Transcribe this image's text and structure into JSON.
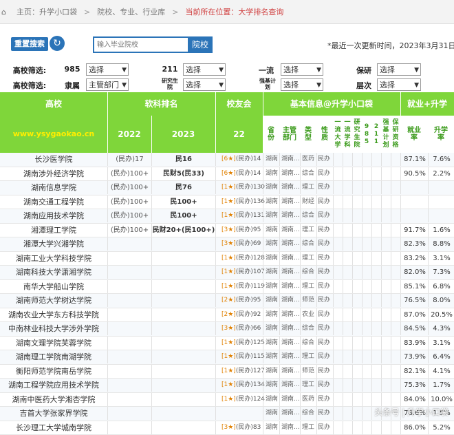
{
  "breadcrumb": {
    "home": "主页",
    "items": [
      "主页：升学小口袋",
      "院校、专业、行业库",
      "当前所在位置：大学排名查询"
    ]
  },
  "search": {
    "logo_label": "重置搜索",
    "placeholder": "输入毕业院校",
    "button": "院校"
  },
  "update": "*最近一次更新时间，2023年3月31日",
  "filters": {
    "row1": [
      {
        "label": "高校筛选:",
        "sublabel": "985",
        "value": "选择"
      },
      {
        "label": "211",
        "value": "选择"
      },
      {
        "label": "一流",
        "value": "选择"
      },
      {
        "label": "保研",
        "value": "选择"
      }
    ],
    "row2": [
      {
        "label": "高校筛选:",
        "sublabel": "隶属",
        "value": "主管部门"
      },
      {
        "label": "研究生院",
        "value": "选择"
      },
      {
        "label": "强基计划",
        "value": "选择"
      },
      {
        "label": "层次",
        "value": "选择"
      }
    ]
  },
  "headers": {
    "school": "高校",
    "ranking": "软科排名",
    "alumni": "校友会",
    "basic": "基本信息@升学小口袋",
    "employ": "就业+升学",
    "site": "www.ysygaokao.cn",
    "y2022": "2022",
    "y2023": "2023",
    "alu22": "22",
    "vcols": [
      "省份",
      "主管部门",
      "类型",
      "性质",
      "一流大学",
      "一流学科",
      "研究生院",
      "985",
      "211",
      "强基计划",
      "保研资格",
      "就业率",
      "升学率"
    ]
  },
  "rows": [
    {
      "name": "长沙医学院",
      "y22": "(民办)17",
      "y23": "民16",
      "alu": "[6★](民办)14",
      "prov": "湖南",
      "dept": "湖南...",
      "type": "医药",
      "nature": "民办",
      "emp": "87.1%",
      "rate": "7.6%"
    },
    {
      "name": "湖南涉外经济学院",
      "y22": "(民办)100+",
      "y23": "民财5(民33)",
      "alu": "[6★](民办)14",
      "prov": "湖南",
      "dept": "湖南...",
      "type": "综合",
      "nature": "民办",
      "emp": "90.5%",
      "rate": "2.2%"
    },
    {
      "name": "湖南信息学院",
      "y22": "(民办)100+",
      "y23": "民76",
      "alu": "[1★](民办)130",
      "prov": "湖南",
      "dept": "湖南...",
      "type": "理工",
      "nature": "民办",
      "emp": "",
      "rate": ""
    },
    {
      "name": "湖南交通工程学院",
      "y22": "(民办)100+",
      "y23": "民100+",
      "alu": "[1★](民办)136",
      "prov": "湖南",
      "dept": "湖南...",
      "type": "财经",
      "nature": "民办",
      "emp": "",
      "rate": ""
    },
    {
      "name": "湖南应用技术学院",
      "y22": "(民办)100+",
      "y23": "民100+",
      "alu": "[1★](民办)131",
      "prov": "湖南",
      "dept": "湖南...",
      "type": "综合",
      "nature": "民办",
      "emp": "",
      "rate": ""
    },
    {
      "name": "湘潭理工学院",
      "y22": "(民办)100+",
      "y23": "民财20+(民100+)",
      "alu": "[3★](民办)95",
      "prov": "湖南",
      "dept": "湖南...",
      "type": "理工",
      "nature": "民办",
      "emp": "91.7%",
      "rate": "1.6%"
    },
    {
      "name": "湘潭大学兴湘学院",
      "y22": "",
      "y23": "",
      "alu": "[3★](民办)69",
      "prov": "湖南",
      "dept": "湖南...",
      "type": "综合",
      "nature": "民办",
      "emp": "82.3%",
      "rate": "8.8%"
    },
    {
      "name": "湖南工业大学科技学院",
      "y22": "",
      "y23": "",
      "alu": "[1★](民办)128",
      "prov": "湖南",
      "dept": "湖南...",
      "type": "理工",
      "nature": "民办",
      "emp": "83.2%",
      "rate": "3.1%"
    },
    {
      "name": "湖南科技大学潇湘学院",
      "y22": "",
      "y23": "",
      "alu": "[1★](民办)107",
      "prov": "湖南",
      "dept": "湖南...",
      "type": "综合",
      "nature": "民办",
      "emp": "82.0%",
      "rate": "7.3%"
    },
    {
      "name": "南华大学船山学院",
      "y22": "",
      "y23": "",
      "alu": "[1★](民办)119",
      "prov": "湖南",
      "dept": "湖南...",
      "type": "理工",
      "nature": "民办",
      "emp": "85.1%",
      "rate": "6.8%"
    },
    {
      "name": "湖南师范大学树达学院",
      "y22": "",
      "y23": "",
      "alu": "[2★](民办)95",
      "prov": "湖南",
      "dept": "湖南...",
      "type": "师范",
      "nature": "民办",
      "emp": "76.5%",
      "rate": "8.0%"
    },
    {
      "name": "湖南农业大学东方科技学院",
      "y22": "",
      "y23": "",
      "alu": "[2★](民办)92",
      "prov": "湖南",
      "dept": "湖南...",
      "type": "农业",
      "nature": "民办",
      "emp": "87.0%",
      "rate": "20.5%"
    },
    {
      "name": "中南林业科技大学涉外学院",
      "y22": "",
      "y23": "",
      "alu": "[3★](民办)66",
      "prov": "湖南",
      "dept": "湖南...",
      "type": "综合",
      "nature": "民办",
      "emp": "84.5%",
      "rate": "4.3%"
    },
    {
      "name": "湖南文理学院芙蓉学院",
      "y22": "",
      "y23": "",
      "alu": "[1★](民办)125",
      "prov": "湖南",
      "dept": "湖南...",
      "type": "综合",
      "nature": "民办",
      "emp": "83.9%",
      "rate": "3.1%"
    },
    {
      "name": "湖南理工学院南湖学院",
      "y22": "",
      "y23": "",
      "alu": "[1★](民办)115",
      "prov": "湖南",
      "dept": "湖南...",
      "type": "理工",
      "nature": "民办",
      "emp": "73.9%",
      "rate": "6.4%"
    },
    {
      "name": "衡阳师范学院南岳学院",
      "y22": "",
      "y23": "",
      "alu": "[1★](民办)127",
      "prov": "湖南",
      "dept": "湖南...",
      "type": "师范",
      "nature": "民办",
      "emp": "82.1%",
      "rate": "4.1%"
    },
    {
      "name": "湖南工程学院应用技术学院",
      "y22": "",
      "y23": "",
      "alu": "[1★](民办)134",
      "prov": "湖南",
      "dept": "湖南...",
      "type": "理工",
      "nature": "民办",
      "emp": "75.3%",
      "rate": "1.7%"
    },
    {
      "name": "湖南中医药大学湘杏学院",
      "y22": "",
      "y23": "",
      "alu": "[1★](民办)124",
      "prov": "湖南",
      "dept": "湖南...",
      "type": "医药",
      "nature": "民办",
      "emp": "84.0%",
      "rate": "10.0%"
    },
    {
      "name": "吉首大学张家界学院",
      "y22": "",
      "y23": "",
      "alu": "",
      "prov": "湖南",
      "dept": "湖南...",
      "type": "综合",
      "nature": "民办",
      "emp": "78.6%",
      "rate": "1.5%"
    },
    {
      "name": "长沙理工大学城南学院",
      "y22": "",
      "y23": "",
      "alu": "[3★](民办)83",
      "prov": "湖南",
      "dept": "湖南...",
      "type": "理工",
      "nature": "民办",
      "emp": "86.0%",
      "rate": "5.2%"
    }
  ],
  "watermark": "头条号 | 升学小口袋"
}
